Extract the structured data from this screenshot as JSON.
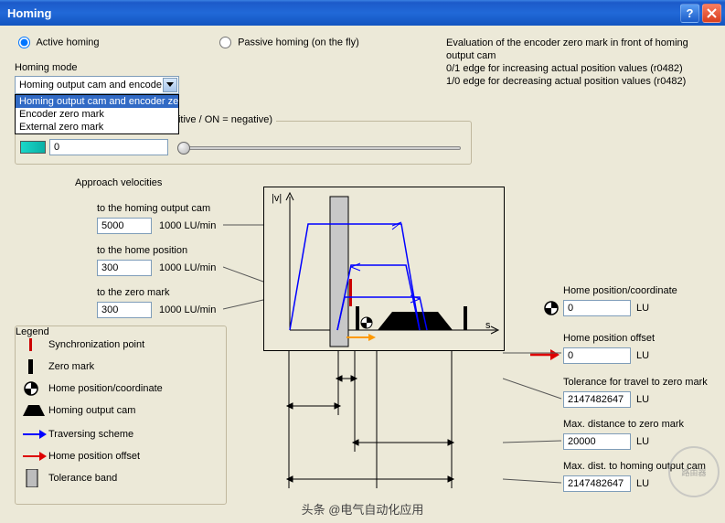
{
  "window": {
    "title": "Homing"
  },
  "radios": {
    "active": "Active homing",
    "passive": "Passive homing (on the fly)"
  },
  "info": {
    "l1": "Evaluation of the encoder zero mark in front of homing output cam",
    "l2": "0/1 edge for increasing actual position values (r0482)",
    "l3": "1/0 edge for decreasing actual position values (r0482)"
  },
  "mode": {
    "label": "Homing mode",
    "selected": "Homing output cam and encode",
    "options": [
      "Homing output cam and encoder ze",
      "Encoder zero mark",
      "External zero mark"
    ]
  },
  "start_dir": {
    "label": "Homing start direction (OFF = positive / ON = negative)",
    "value": "0"
  },
  "approach": {
    "title": "Approach velocities",
    "cam": {
      "label": "to the homing output cam",
      "value": "5000",
      "unit": "1000 LU/min"
    },
    "home": {
      "label": "to the home position",
      "value": "300",
      "unit": "1000 LU/min"
    },
    "zero": {
      "label": "to the zero mark",
      "value": "300",
      "unit": "1000 LU/min"
    }
  },
  "legend": {
    "title": "Legend",
    "sync": "Synchronization point",
    "zero": "Zero mark",
    "home": "Home position/coordinate",
    "cam": "Homing output cam",
    "trav": "Traversing scheme",
    "offset": "Home position offset",
    "tol": "Tolerance band"
  },
  "params": {
    "home_pos": {
      "label": "Home position/coordinate",
      "value": "0",
      "unit": "LU"
    },
    "home_off": {
      "label": "Home position offset",
      "value": "0",
      "unit": "LU"
    },
    "tol": {
      "label": "Tolerance for travel to zero mark",
      "value": "2147482647",
      "unit": "LU"
    },
    "max_zero": {
      "label": "Max. distance to zero mark",
      "value": "20000",
      "unit": "LU"
    },
    "max_cam": {
      "label": "Max. dist. to homing output cam",
      "value": "2147482647",
      "unit": "LU"
    }
  },
  "diagram": {
    "y_axis": "|v|",
    "x_axis": "s"
  },
  "attribution": "头条 @电气自动化应用",
  "watermark": "路由器"
}
